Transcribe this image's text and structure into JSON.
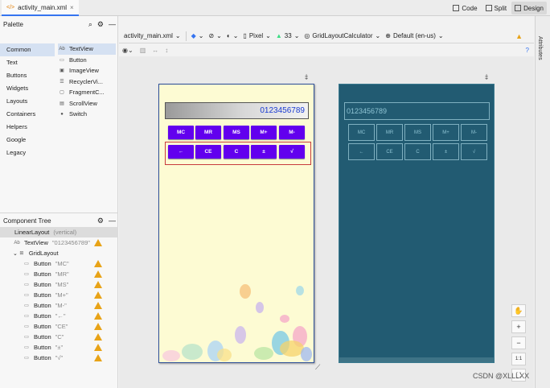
{
  "tabs": [
    {
      "label": "activity_main.xml"
    }
  ],
  "view_modes": [
    {
      "label": "Code"
    },
    {
      "label": "Split"
    },
    {
      "label": "Design"
    }
  ],
  "palette": {
    "title": "Palette",
    "categories": [
      "Common",
      "Text",
      "Buttons",
      "Widgets",
      "Layouts",
      "Containers",
      "Helpers",
      "Google",
      "Legacy"
    ],
    "widgets": [
      {
        "icon": "Ab",
        "label": "TextView"
      },
      {
        "icon": "▭",
        "label": "Button"
      },
      {
        "icon": "▣",
        "label": "ImageView"
      },
      {
        "icon": "☰",
        "label": "RecyclerVi..."
      },
      {
        "icon": "▢",
        "label": "FragmentC..."
      },
      {
        "icon": "▤",
        "label": "ScrollView"
      },
      {
        "icon": "●",
        "label": "Switch"
      }
    ]
  },
  "component_tree": {
    "title": "Component Tree",
    "rows": [
      {
        "indent": 0,
        "icon": "",
        "label": "LinearLayout",
        "sub": "(vertical)",
        "warn": false
      },
      {
        "indent": 1,
        "icon": "Ab",
        "label": "TextView",
        "sub": "\"0123456789\"",
        "warn": true
      },
      {
        "indent": 1,
        "icon": "⊞",
        "label": "GridLayout",
        "sub": "",
        "warn": false
      },
      {
        "indent": 2,
        "icon": "▭",
        "label": "Button",
        "sub": "\"MC\"",
        "warn": true
      },
      {
        "indent": 2,
        "icon": "▭",
        "label": "Button",
        "sub": "\"MR\"",
        "warn": true
      },
      {
        "indent": 2,
        "icon": "▭",
        "label": "Button",
        "sub": "\"MS\"",
        "warn": true
      },
      {
        "indent": 2,
        "icon": "▭",
        "label": "Button",
        "sub": "\"M+\"",
        "warn": true
      },
      {
        "indent": 2,
        "icon": "▭",
        "label": "Button",
        "sub": "\"M-\"",
        "warn": true
      },
      {
        "indent": 2,
        "icon": "▭",
        "label": "Button",
        "sub": "\"←\"",
        "warn": true
      },
      {
        "indent": 2,
        "icon": "▭",
        "label": "Button",
        "sub": "\"CE\"",
        "warn": true
      },
      {
        "indent": 2,
        "icon": "▭",
        "label": "Button",
        "sub": "\"C\"",
        "warn": true
      },
      {
        "indent": 2,
        "icon": "▭",
        "label": "Button",
        "sub": "\"±\"",
        "warn": true
      },
      {
        "indent": 2,
        "icon": "▭",
        "label": "Button",
        "sub": "\"√\"",
        "warn": true
      }
    ]
  },
  "toolbar": {
    "file": "activity_main.xml",
    "device": "Pixel",
    "api": "33",
    "theme": "GridLayoutCalculator",
    "locale": "Default (en-us)"
  },
  "attributes_label": "Attributes",
  "calculator": {
    "display": "0123456789",
    "row1": [
      "MC",
      "MR",
      "MS",
      "M+",
      "M-"
    ],
    "row2": [
      "←",
      "CE",
      "C",
      "±",
      "√"
    ]
  },
  "zoom": [
    "+",
    "−",
    "1:1"
  ],
  "watermark": "CSDN @XLLLXX",
  "colors": {
    "accent": "#6200ee",
    "display_text": "#1a3bd1",
    "blueprint": "#225b72",
    "warning": "#e8a317"
  }
}
